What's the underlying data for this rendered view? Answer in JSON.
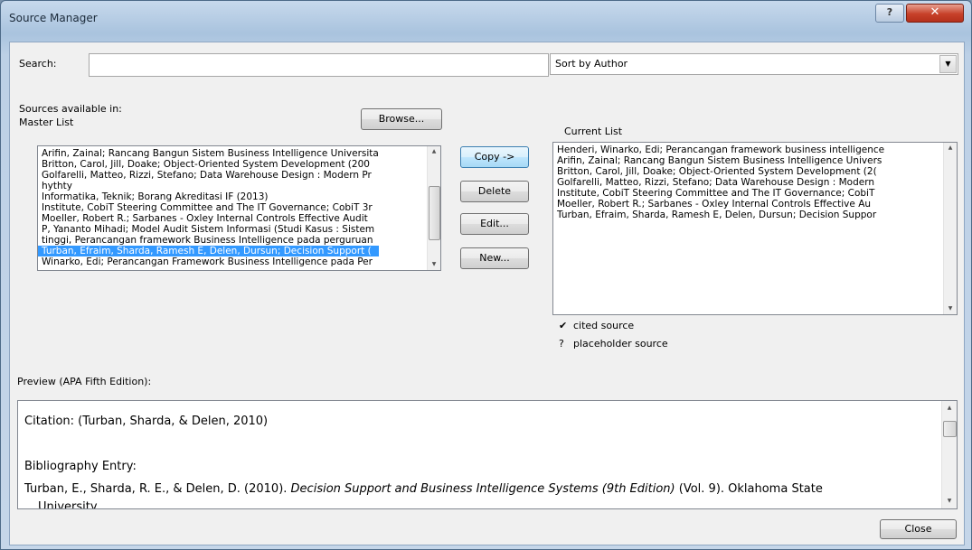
{
  "window": {
    "title": "Source Manager",
    "help_glyph": "?",
    "close_glyph": "✕"
  },
  "search": {
    "label": "Search:",
    "value": "",
    "placeholder": ""
  },
  "sort": {
    "value": "Sort by Author",
    "arrow_icon": "chevron-down-icon"
  },
  "sources": {
    "label": "Sources available in:",
    "master_label": "Master List",
    "browse_label": "Browse..."
  },
  "master_list": {
    "items": [
      "Arifin, Zainal; Rancang Bangun Sistem Business Intelligence Universita",
      "Britton, Carol, Jill, Doake; Object-Oriented System Development (200",
      "Golfarelli, Matteo, Rizzi, Stefano; Data Warehouse Design : Modern Pr",
      "hythty",
      "Informatika, Teknik; Borang Akreditasi IF (2013)",
      "Institute, CobiT Steering Committee and The IT Governance; CobiT 3r",
      "Moeller, Robert R.; Sarbanes - Oxley Internal Controls Effective Audit",
      "P, Yananto Mihadi; Model Audit Sistem Informasi (Studi Kasus : Sistem",
      "tinggi, Perancangan framework Business Intelligence pada perguruan",
      "Turban, Efraim, Sharda, Ramesh E, Delen, Dursun; Decision Support (",
      "Winarko, Edi; Perancangan Framework Business Intelligence pada Per"
    ],
    "selected_index": 9
  },
  "actions": {
    "copy": "Copy ->",
    "delete": "Delete",
    "edit": "Edit...",
    "new": "New..."
  },
  "current": {
    "label": "Current List",
    "items": [
      "Henderi, Winarko, Edi; Perancangan framework business intelligence",
      "Arifin, Zainal; Rancang Bangun Sistem Business Intelligence Univers",
      "Britton, Carol, Jill, Doake; Object-Oriented System Development (2(",
      "Golfarelli, Matteo, Rizzi, Stefano; Data Warehouse Design : Modern",
      "Institute, CobiT Steering Committee and The IT Governance; CobiT",
      "Moeller, Robert R.; Sarbanes - Oxley Internal Controls Effective Au",
      "Turban, Efraim, Sharda, Ramesh E, Delen, Dursun; Decision Suppor"
    ]
  },
  "legend": {
    "cited_symbol": "✔",
    "cited_label": "cited source",
    "placeholder_symbol": "?",
    "placeholder_label": "placeholder source"
  },
  "preview": {
    "label": "Preview (APA Fifth Edition):",
    "citation": "Citation:  (Turban, Sharda, & Delen, 2010)",
    "bib_heading": "Bibliography Entry:",
    "bib_entry_prefix": "Turban, E., Sharda, R. E., & Delen, D. (2010). ",
    "bib_entry_title": "Decision Support and Business Intelligence Systems (9th Edition)",
    "bib_entry_suffix": " (Vol. 9). Oklahoma State",
    "bib_entry_cont": "University."
  },
  "footer": {
    "close_label": "Close"
  }
}
